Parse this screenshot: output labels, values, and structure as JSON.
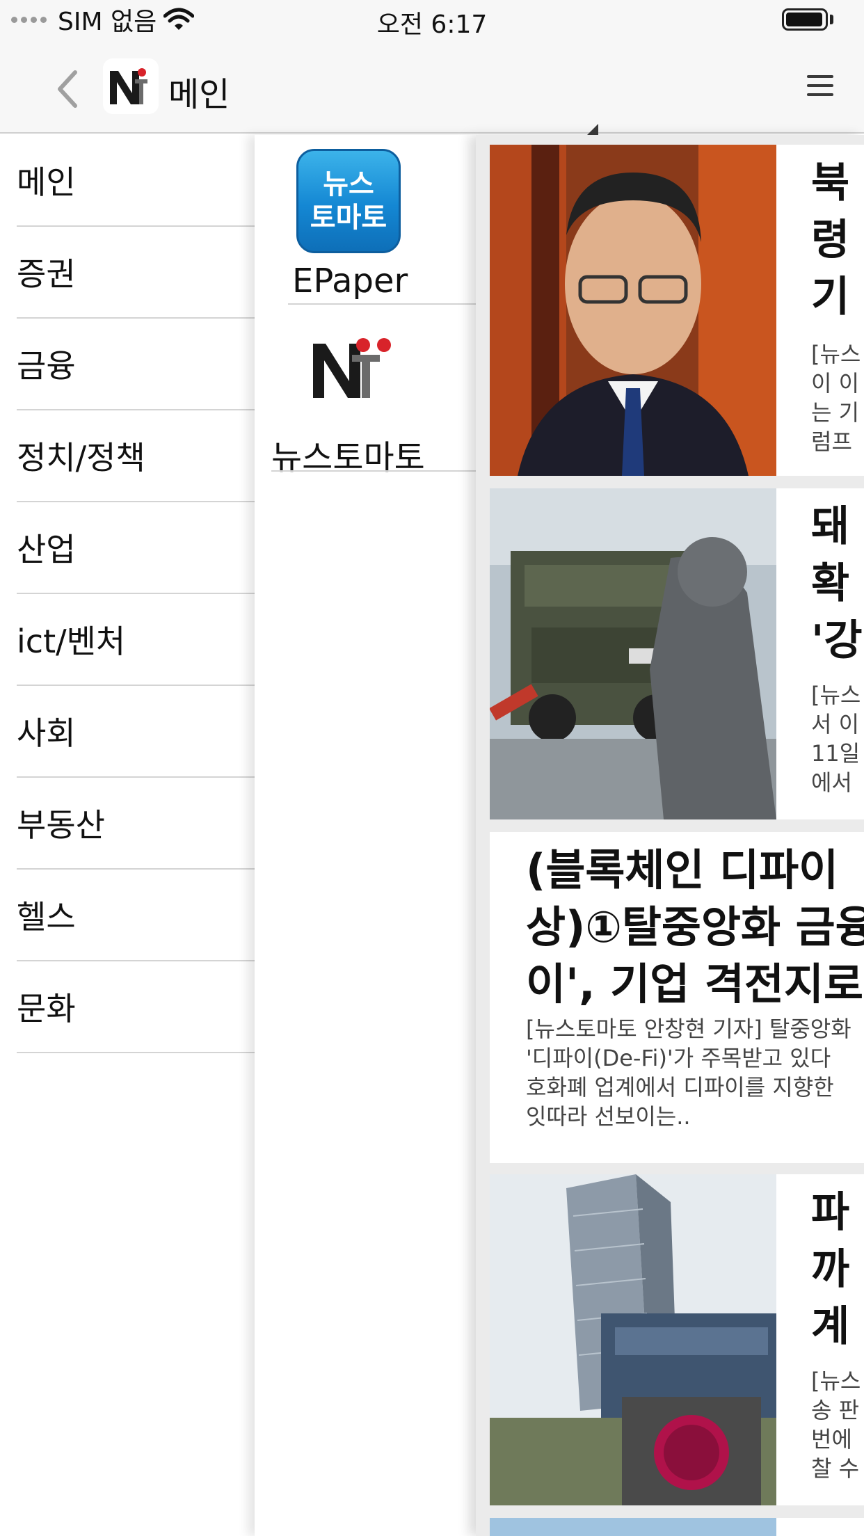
{
  "status_bar": {
    "carrier": "SIM 없음",
    "time": "오전 6:17",
    "icons": [
      "signal-dots-icon",
      "wifi-icon",
      "battery-icon"
    ]
  },
  "nav_bar": {
    "title": "메인",
    "back_icon": "chevron-left-icon",
    "logo_icon": "newstomato-logo-icon",
    "dropdown_icon": "triangle-icon",
    "menu_icon": "hamburger-menu-icon"
  },
  "sidebar": {
    "items": [
      {
        "label": "메인"
      },
      {
        "label": "증권"
      },
      {
        "label": "금융"
      },
      {
        "label": "정치/정책"
      },
      {
        "label": "산업"
      },
      {
        "label": "ict/벤처"
      },
      {
        "label": "사회"
      },
      {
        "label": "부동산"
      },
      {
        "label": "헬스"
      },
      {
        "label": "문화"
      }
    ]
  },
  "submenu": {
    "epaper_icon_text": [
      "뉴스",
      "토마토"
    ],
    "epaper_label": "EPaper",
    "newstomato_label": "뉴스토마토"
  },
  "articles": [
    {
      "title_lines": [
        "북",
        "령",
        "기"
      ],
      "summary_lines": [
        "[뉴스",
        "이 이",
        "는 기",
        "럼프"
      ],
      "image": "portrait-photo"
    },
    {
      "title_lines": [
        "돼",
        "확",
        "'강"
      ],
      "summary_lines": [
        "[뉴스",
        "서 이",
        "11일",
        "에서"
      ],
      "image": "disinfection-truck-photo"
    },
    {
      "title_lines": [
        "(블록체인 디파이 ",
        "상)①탈중앙화 금융",
        "이', 기업 격전지로"
      ],
      "summary_lines": [
        "[뉴스토마토 안창현 기자] 탈중앙화",
        "'디파이(De-Fi)'가 주목받고 있다",
        "호화폐 업계에서 디파이를 지향한",
        "잇따라 선보이는.."
      ]
    },
    {
      "title_lines": [
        "파",
        "까",
        "계"
      ],
      "summary_lines": [
        "[뉴스",
        "송 판",
        "번에",
        "찰 수"
      ],
      "image": "lg-tower-photo"
    }
  ],
  "colors": {
    "bar_background": "#f7f7f7",
    "content_background": "#ebebeb",
    "epaper_blue": "#1487d3",
    "logo_red": "#d8232a"
  }
}
